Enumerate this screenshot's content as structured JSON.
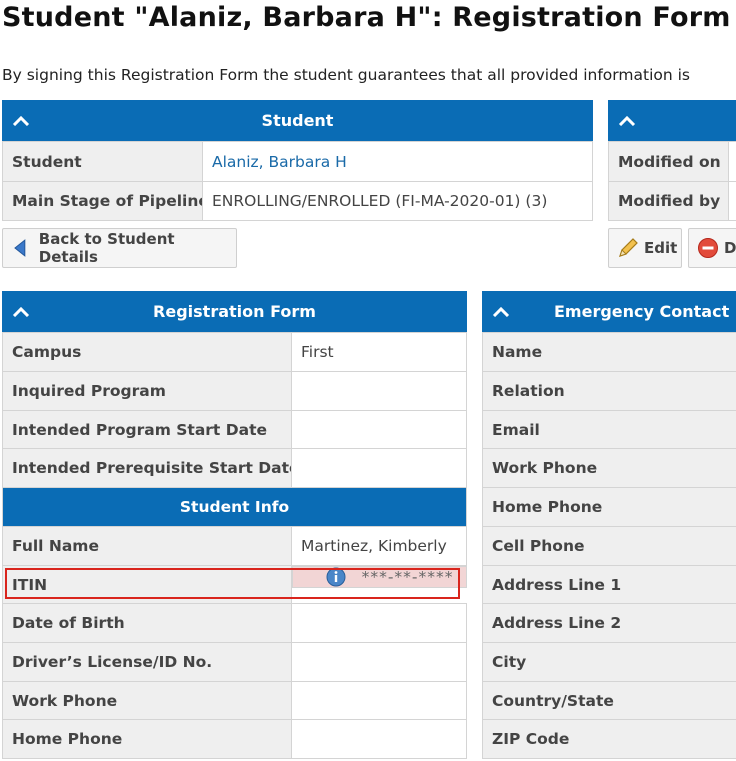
{
  "page": {
    "title": "Student \"Alaniz, Barbara H\": Registration Form",
    "intro": "By signing this Registration Form the student guarantees that all provided information is"
  },
  "student_panel": {
    "header": "Student",
    "rows": [
      {
        "label": "Student",
        "value": "Alaniz, Barbara H"
      },
      {
        "label": "Main Stage of Pipeline",
        "value": "ENROLLING/ENROLLED (FI-MA-2020-01) (3)"
      }
    ]
  },
  "meta_panel": {
    "rows": [
      {
        "label": "Modified on"
      },
      {
        "label": "Modified by"
      }
    ]
  },
  "buttons": {
    "back": "Back to Student Details",
    "edit": "Edit",
    "delete": "D"
  },
  "registration_form": {
    "header": "Registration Form",
    "rows": [
      {
        "label": "Campus",
        "value": "First"
      },
      {
        "label": "Inquired Program",
        "value": ""
      },
      {
        "label": "Intended Program Start Date",
        "value": ""
      },
      {
        "label": "Intended Prerequisite Start Date",
        "value": ""
      }
    ]
  },
  "student_info": {
    "header": "Student Info",
    "rows": [
      {
        "label": "Full Name",
        "value": "Martinez, Kimberly"
      },
      {
        "label": "ITIN",
        "value": "***-**-****"
      },
      {
        "label": "Date of Birth",
        "value": ""
      },
      {
        "label": "Driver’s License/ID No.",
        "value": ""
      },
      {
        "label": "Work Phone",
        "value": ""
      },
      {
        "label": "Home Phone",
        "value": ""
      }
    ]
  },
  "emergency_contact": {
    "header": "Emergency Contact",
    "rows": [
      {
        "label": "Name"
      },
      {
        "label": "Relation"
      },
      {
        "label": "Email"
      },
      {
        "label": "Work Phone"
      },
      {
        "label": "Home Phone"
      },
      {
        "label": "Cell Phone"
      },
      {
        "label": "Address Line 1"
      },
      {
        "label": "Address Line 2"
      },
      {
        "label": "City"
      },
      {
        "label": "Country/State"
      },
      {
        "label": "ZIP Code"
      }
    ]
  },
  "colors": {
    "header_blue": "#0a6cb5",
    "label_bg": "#efefef",
    "link": "#1a6aa8",
    "highlight": "#d9251d"
  },
  "icons": [
    "chevron-up-icon",
    "arrow-left-icon",
    "pencil-icon",
    "delete-icon",
    "info-icon"
  ]
}
